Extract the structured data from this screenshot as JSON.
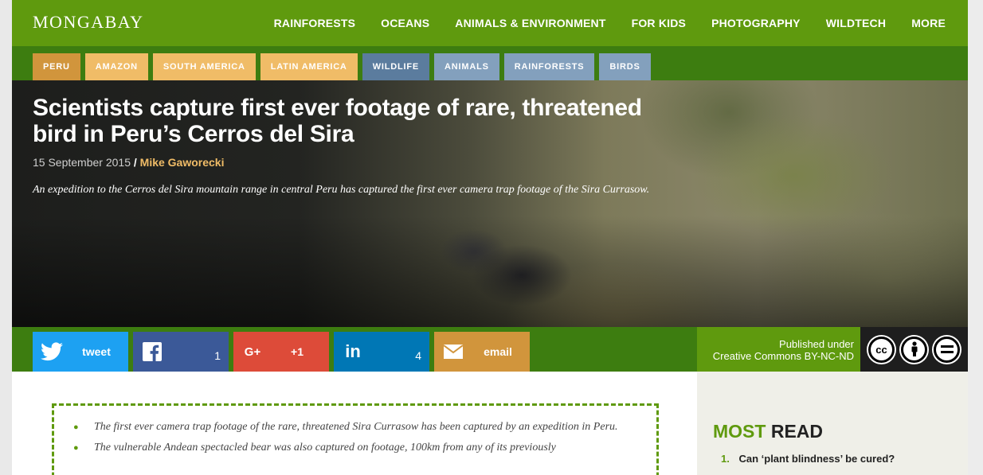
{
  "header": {
    "logo": "MONGABAY",
    "nav": [
      "RAINFORESTS",
      "OCEANS",
      "ANIMALS & ENVIRONMENT",
      "FOR KIDS",
      "PHOTOGRAPHY",
      "WILDTECH",
      "MORE"
    ]
  },
  "tags": [
    "PERU",
    "AMAZON",
    "SOUTH AMERICA",
    "LATIN AMERICA",
    "WILDLIFE",
    "ANIMALS",
    "RAINFORESTS",
    "BIRDS"
  ],
  "article": {
    "title": "Scientists capture first ever footage of rare, threatened bird in Peru’s Cerros del Sira",
    "date": "15 September 2015",
    "separator": "/",
    "author": "Mike Gaworecki",
    "dek": "An expedition to the Cerros del Sira mountain range in central Peru has captured the first ever camera trap footage of the Sira Currasow."
  },
  "share": {
    "tweet_label": "tweet",
    "facebook_count": "1",
    "gplus_label": "+1",
    "linkedin_count": "4",
    "email_label": "email"
  },
  "license": {
    "line1": "Published under",
    "line2": "Creative Commons BY-NC-ND"
  },
  "summary": {
    "bullets": [
      "The first ever camera trap footage of the rare, threatened Sira Currasow has been captured by an expedition in Peru.",
      "The vulnerable Andean spectacled bear was also captured on footage, 100km from any of its previously"
    ]
  },
  "most_read": {
    "heading_green": "MOST",
    "heading_dark": "READ",
    "items": [
      {
        "number": "1.",
        "title": "Can ‘plant blindness’ be cured?"
      }
    ]
  },
  "colors": {
    "brand_green": "#5f9a0e",
    "dark_green": "#3d7d10",
    "twitter": "#1da1f2",
    "facebook": "#3b5998",
    "gplus": "#dd4b39",
    "linkedin": "#0077b5",
    "email": "#d1953c"
  }
}
